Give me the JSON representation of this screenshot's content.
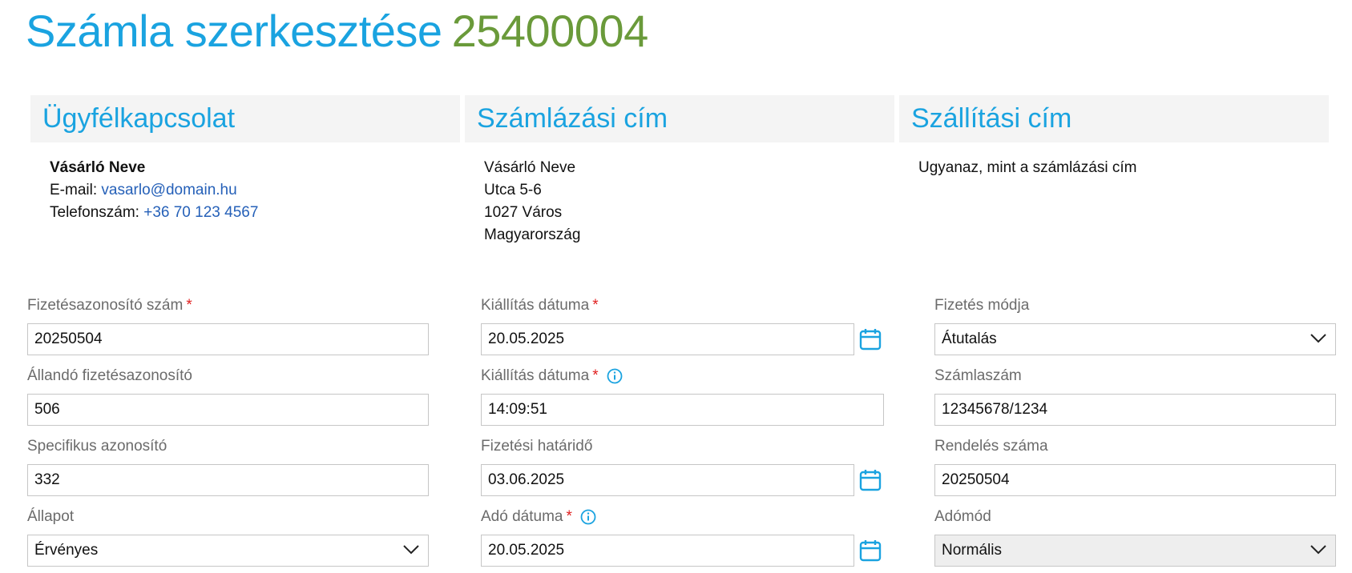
{
  "header": {
    "title": "Számla szerkesztése",
    "invoice_number": "25400004"
  },
  "panels": {
    "customer": {
      "heading": "Ügyfélkapcsolat",
      "name": "Vásárló Neve",
      "email_label": "E-mail:",
      "email": "vasarlo@domain.hu",
      "phone_label": "Telefonszám:",
      "phone": "+36 70 123 4567"
    },
    "billing": {
      "heading": "Számlázási cím",
      "lines": [
        "Vásárló Neve",
        "Utca 5-6",
        "1027 Város",
        "Magyarország"
      ]
    },
    "shipping": {
      "heading": "Szállítási cím",
      "text": "Ugyanaz, mint a számlázási cím"
    }
  },
  "form": {
    "col1": [
      {
        "label": "Fizetésazonosító szám",
        "required": "*",
        "value": "20250504"
      },
      {
        "label": "Állandó fizetésazonosító",
        "value": "506"
      },
      {
        "label": "Specifikus azonosító",
        "value": "332"
      },
      {
        "label": "Állapot",
        "value": "Érvényes"
      }
    ],
    "col2": [
      {
        "label": "Kiállítás dátuma",
        "required": "*",
        "value": "20.05.2025"
      },
      {
        "label": "Kiállítás dátuma",
        "required": "*",
        "value": "14:09:51"
      },
      {
        "label": "Fizetési határidő",
        "value": "03.06.2025"
      },
      {
        "label": "Adó dátuma",
        "required": "*",
        "value": "20.05.2025"
      }
    ],
    "col3": [
      {
        "label": "Fizetés módja",
        "value": "Átutalás"
      },
      {
        "label": "Számlaszám",
        "value": "12345678/1234"
      },
      {
        "label": "Rendelés száma",
        "value": "20250504"
      },
      {
        "label": "Adómód",
        "value": "Normális"
      }
    ]
  },
  "colors": {
    "accent": "#1aa3e0",
    "invoice_number": "#6a9a3a",
    "link": "#2560b8",
    "required": "#e02020"
  },
  "icons": [
    "calendar-icon",
    "info-icon",
    "chevron-down-icon"
  ]
}
